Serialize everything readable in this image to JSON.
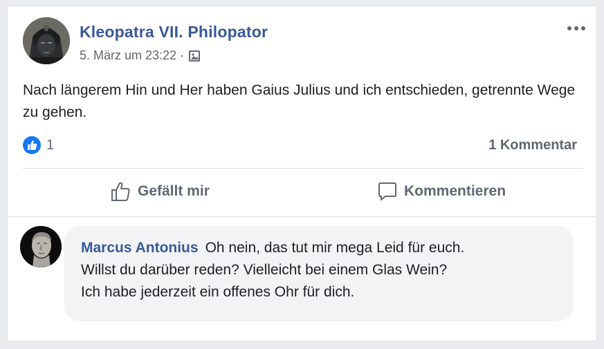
{
  "post": {
    "author": "Kleopatra VII. Philopator",
    "timestamp": "5. März um 23:22 ·",
    "audience_icon": "album-icon",
    "text": "Nach längerem Hin und Her haben Gaius Julius und ich entschieden, getrennte Wege zu gehen.",
    "likes_count": "1",
    "comments_count": "1 Kommentar"
  },
  "actions": {
    "like_label": "Gefällt mir",
    "comment_label": "Kommentieren"
  },
  "comment": {
    "author": "Marcus Antonius",
    "lines": [
      "Oh nein, das tut mir mega Leid für euch.",
      "Willst du darüber reden? Vielleicht bei einem Glas Wein?",
      "Ich habe jederzeit ein offenes Ohr für dich."
    ]
  },
  "colors": {
    "link_blue": "#385898",
    "like_blue": "#1877f2",
    "secondary_text": "#606770",
    "bubble_bg": "#f2f3f5"
  }
}
